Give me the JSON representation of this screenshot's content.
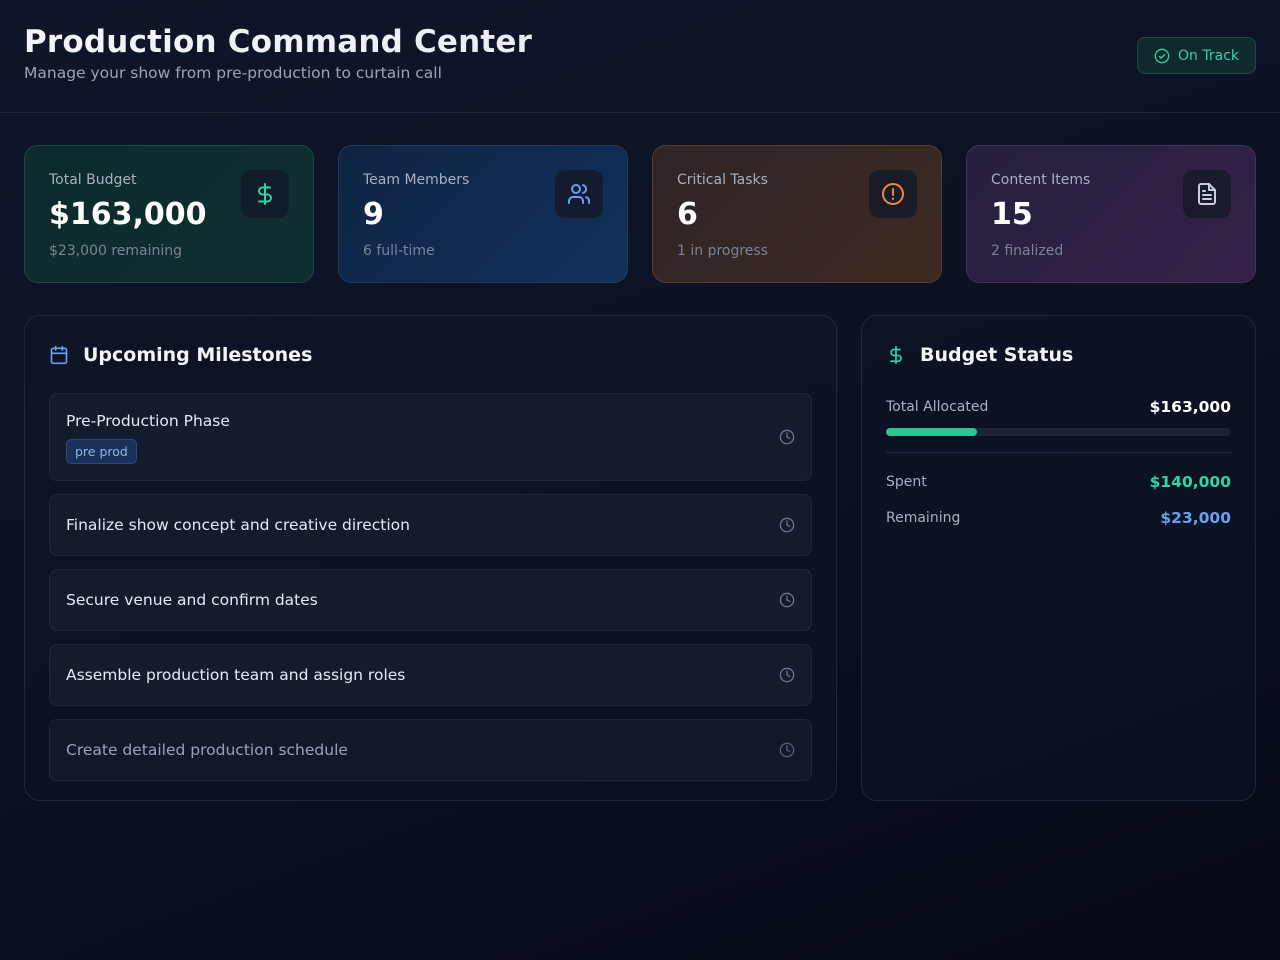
{
  "header": {
    "title": "Production Command Center",
    "subtitle": "Manage your show from pre-production to curtain call",
    "status": "On Track",
    "status_icon": "check-circle-icon"
  },
  "stats": [
    {
      "label": "Total Budget",
      "value": "$163,000",
      "sub": "$23,000 remaining",
      "icon": "dollar-icon",
      "color": "#34d3a6"
    },
    {
      "label": "Team Members",
      "value": "9",
      "sub": "6 full-time",
      "icon": "users-icon",
      "color": "#6aa0ef"
    },
    {
      "label": "Critical Tasks",
      "value": "6",
      "sub": "1 in progress",
      "icon": "alert-circle-icon",
      "color": "#f0883e"
    },
    {
      "label": "Content Items",
      "value": "15",
      "sub": "2 finalized",
      "icon": "document-icon",
      "color": "#c9cfdb"
    }
  ],
  "milestones": {
    "title": "Upcoming Milestones",
    "icon": "calendar-icon",
    "items": [
      {
        "label": "Pre-Production Phase",
        "tag": "pre prod"
      },
      {
        "label": "Finalize show concept and creative direction"
      },
      {
        "label": "Secure venue and confirm dates"
      },
      {
        "label": "Assemble production team and assign roles"
      },
      {
        "label": "Create detailed production schedule"
      }
    ]
  },
  "budget": {
    "title": "Budget Status",
    "icon": "dollar-icon",
    "allocated_label": "Total Allocated",
    "allocated_value": "$163,000",
    "spent_fraction": 0.264,
    "spent_label": "Spent",
    "spent_value": "$140,000",
    "remaining_label": "Remaining",
    "remaining_value": "$23,000"
  },
  "colors": {
    "accent_green": "#34d3a6",
    "accent_blue": "#6aa0ef",
    "accent_orange": "#f0883e"
  }
}
